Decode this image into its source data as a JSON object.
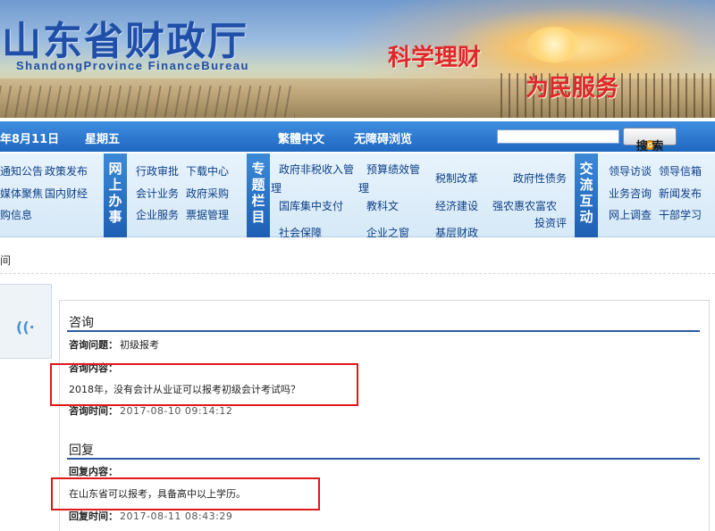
{
  "banner": {
    "title": "山东省财政厅",
    "subtitle": "ShandongProvince  FinanceBureau",
    "slogan1": "科学理财",
    "slogan2": "为民服务"
  },
  "topbar": {
    "date": "年8月11日",
    "weekday": "星期五",
    "traditional": "繁體中文",
    "accessible": "无障碍浏览",
    "search_label": "搜 索",
    "search_placeholder": ""
  },
  "nav": {
    "left_links": [
      "通知公告",
      "政策发布",
      "媒体聚焦",
      "国内财经",
      "购信息"
    ],
    "online_service_tab": "网上办事",
    "online_links": [
      "行政审批",
      "下载中心",
      "会计业务",
      "政府采购",
      "企业服务",
      "票据管理"
    ],
    "special_tab": "专题栏目",
    "special_links": [
      "政府非税收入管",
      "理",
      "预算绩效管",
      "理",
      "税制改革",
      "政府性债务",
      "国库集中支付",
      "教科文",
      "经济建设",
      "强农惠农富农",
      "投资评",
      "社会保障",
      "企业之窗",
      "基层财政"
    ],
    "exchange_tab": "交流互动",
    "exchange_links": [
      "领导访谈",
      "领导信箱",
      "业务咨询",
      "新闻发布",
      "网上调查",
      "干部学习"
    ]
  },
  "breadcrumb": "间",
  "consult": {
    "section_title": "咨询",
    "question_label": "咨询问题：",
    "question_value": "初级报考",
    "content_label": "咨询内容：",
    "content_value": "2018年，没有会计从业证可以报考初级会计考试吗？",
    "time_label": "咨询时间：",
    "time_value": "2017-08-10 09:14:12"
  },
  "reply": {
    "section_title": "回复",
    "content_label": "回复内容：",
    "content_value": "在山东省可以报考，具备高中以上学历。",
    "time_label": "回复时间：",
    "time_value": "2017-08-11 08:43:29"
  },
  "colors": {
    "brand_blue": "#1f68c1",
    "slogan_red": "#e0262b",
    "highlight_red": "#e01818"
  },
  "icons": {
    "widget": "audio-wave-icon",
    "search": "search-icon"
  }
}
